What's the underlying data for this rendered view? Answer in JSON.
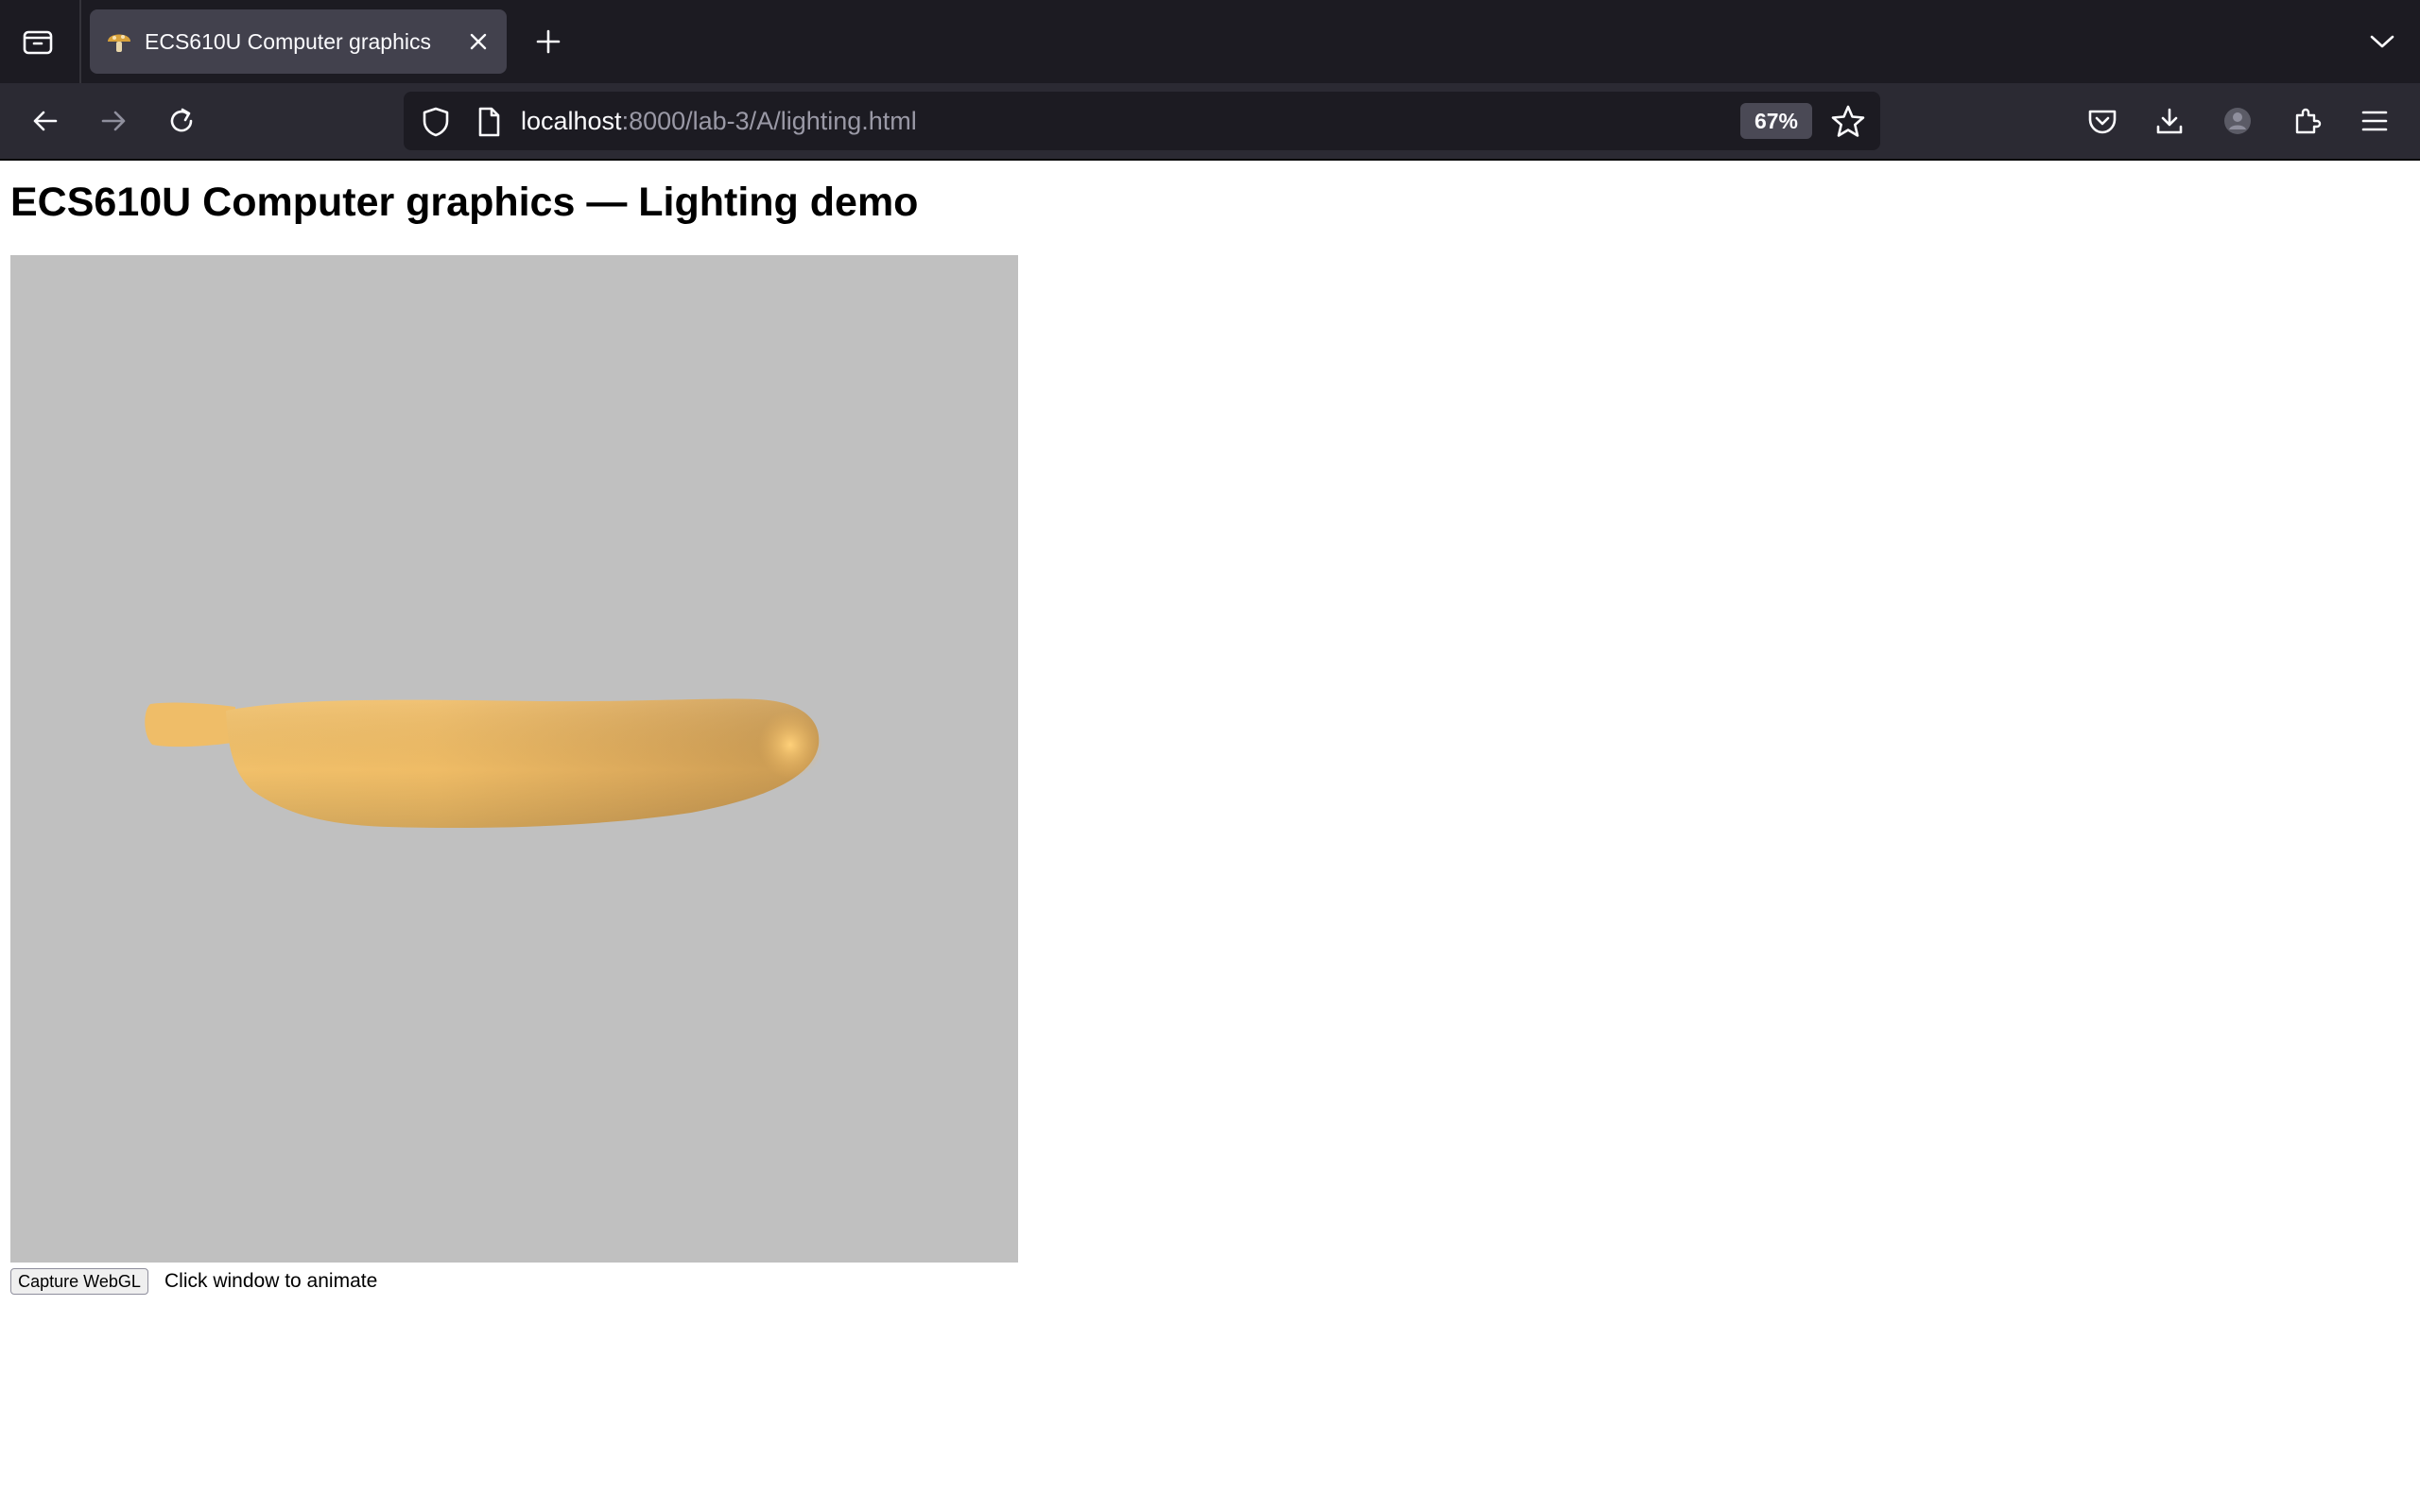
{
  "browser": {
    "tab": {
      "title": "ECS610U Computer graphics",
      "favicon": "mushroom-icon"
    },
    "toolbar": {
      "url_host": "localhost",
      "url_rest": ":8000/lab-3/A/lighting.html",
      "zoom_level": "67%"
    },
    "icons": {
      "tab_list": "tab-list-icon",
      "tab_close": "close-icon",
      "new_tab": "plus-icon",
      "tab_overflow": "chevron-down-icon",
      "back": "back-arrow-icon",
      "forward": "forward-arrow-icon",
      "reload": "reload-icon",
      "tracking_protection": "shield-icon",
      "page_info": "page-icon",
      "bookmark": "star-icon",
      "pocket": "pocket-icon",
      "downloads": "download-icon",
      "account": "account-icon",
      "extensions": "puzzle-icon",
      "menu": "hamburger-menu-icon"
    },
    "colors": {
      "tabbar_bg": "#1c1b22",
      "toolbar_bg": "#2b2a33",
      "urlbar_bg": "#1c1b22",
      "active_tab_bg": "#42414d"
    }
  },
  "page": {
    "heading": "ECS610U Computer graphics — Lighting demo",
    "canvas": {
      "background": "#c0c0c0",
      "object": "banana",
      "object_color": "#e8b45e"
    },
    "capture_button_label": "Capture WebGL",
    "hint": "Click window to animate"
  }
}
